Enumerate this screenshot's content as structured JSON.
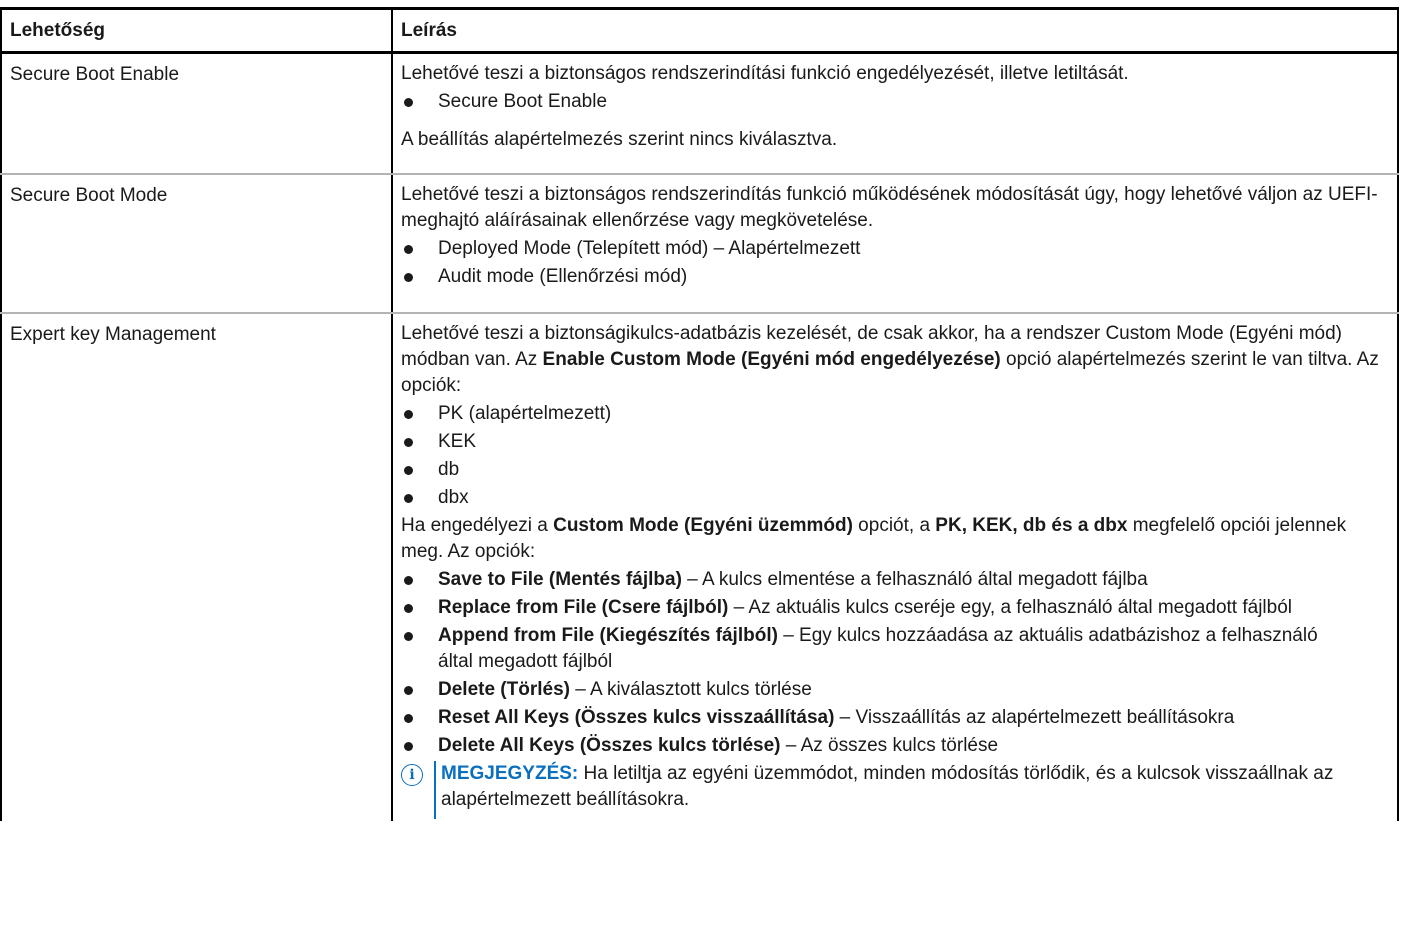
{
  "table": {
    "headers": [
      "Lehetőség",
      "Leírás"
    ],
    "rows": {
      "secure_boot_enable": {
        "name": "Secure Boot Enable",
        "desc": "Lehetővé teszi a biztonságos rendszerindítási funkció engedélyezését, illetve letiltását.",
        "bullets": [
          "Secure Boot Enable"
        ],
        "after": "A beállítás alapértelmezés szerint nincs kiválasztva."
      },
      "secure_boot_mode": {
        "name": "Secure Boot Mode",
        "desc": "Lehetővé teszi a biztonságos rendszerindítás funkció működésének módosítását úgy, hogy lehetővé váljon az UEFI-meghajtó aláírásainak ellenőrzése vagy megkövetelése.",
        "bullets": [
          "Deployed Mode (Telepített mód) – Alapértelmezett",
          "Audit mode (Ellenőrzési mód)"
        ]
      },
      "expert_key": {
        "name": "Expert key Management",
        "desc1_a": "Lehetővé teszi a biztonságikulcs-adatbázis kezelését, de csak akkor, ha a rendszer Custom Mode (Egyéni mód) módban van. Az ",
        "desc1_bold": "Enable Custom Mode (Egyéni mód engedélyezése)",
        "desc1_b": " opció alapértelmezés szerint le van tiltva. Az opciók:",
        "key_bullets": [
          "PK (alapértelmezett)",
          "KEK",
          "db",
          "dbx"
        ],
        "desc2_a": "Ha engedélyezi a ",
        "desc2_bold1": "Custom Mode (Egyéni üzemmód)",
        "desc2_b": " opciót, a ",
        "desc2_bold2": "PK, KEK, db és a dbx",
        "desc2_c": " megfelelő opciói jelennek meg. Az opciók:",
        "options": [
          {
            "label": "Save to File (Mentés fájlba)",
            "text": " – A kulcs elmentése a felhasználó által megadott fájlba"
          },
          {
            "label": "Replace from File (Csere fájlból)",
            "text": " – Az aktuális kulcs cseréje egy, a felhasználó által megadott fájlból"
          },
          {
            "label": "Append from File (Kiegészítés fájlból)",
            "text": " – Egy kulcs hozzáadása az aktuális adatbázishoz a felhasználó által megadott fájlból"
          },
          {
            "label": "Delete (Törlés)",
            "text": " – A kiválasztott kulcs törlése"
          },
          {
            "label": "Reset All Keys (Összes kulcs visszaállítása)",
            "text": " – Visszaállítás az alapértelmezett beállításokra"
          },
          {
            "label": "Delete All Keys (Összes kulcs törlése)",
            "text": " – Az összes kulcs törlése"
          }
        ],
        "note_label": "MEGJEGYZÉS:",
        "note_text": " Ha letiltja az egyéni üzemmódot, minden módosítás törlődik, és a kulcsok visszaállnak az alapértelmezett beállításokra."
      }
    }
  },
  "colors": {
    "note_accent": "#0a6fbf",
    "row_divider": "#b4b4b4"
  },
  "icons": {
    "note": "info-circle-icon"
  }
}
